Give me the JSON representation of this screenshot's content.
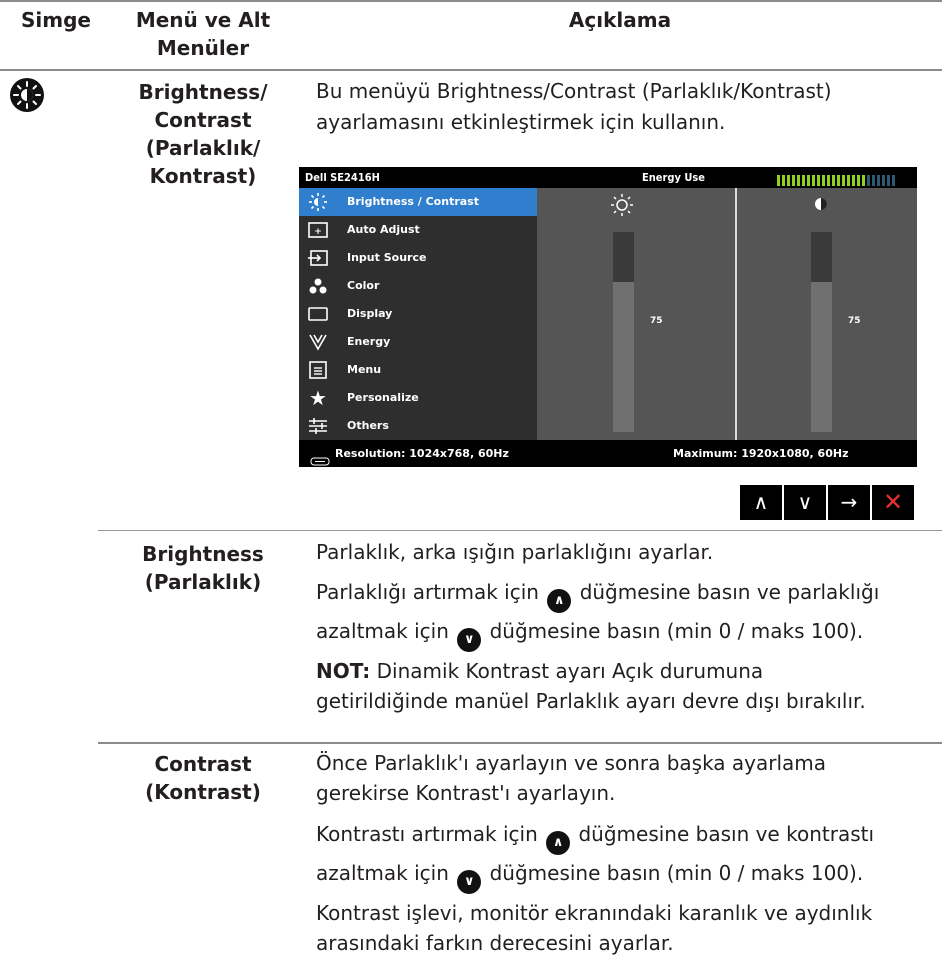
{
  "header": {
    "col_icon": "Simge",
    "col_menu": "Menü ve Alt Menüler",
    "col_desc": "Açıklama"
  },
  "main_row": {
    "icon": "brightness-contrast-icon",
    "menu_label_lines": [
      "Brightness/",
      "Contrast",
      "(Parlaklık/",
      "Kontrast)"
    ],
    "description": "Bu menüyü Brightness/Contrast (Parlaklık/Kontrast) ayarlamasını etkinleştirmek için kullanın."
  },
  "osd": {
    "model": "Dell SE2416H",
    "energy_label": "Energy Use",
    "menu_items": [
      {
        "label": "Brightness / Contrast",
        "icon": "brightness-icon",
        "selected": true
      },
      {
        "label": "Auto Adjust",
        "icon": "auto-adjust-icon",
        "selected": false
      },
      {
        "label": "Input Source",
        "icon": "input-source-icon",
        "selected": false
      },
      {
        "label": "Color",
        "icon": "color-icon",
        "selected": false
      },
      {
        "label": "Display",
        "icon": "display-icon",
        "selected": false
      },
      {
        "label": "Energy",
        "icon": "energy-icon",
        "selected": false
      },
      {
        "label": "Menu",
        "icon": "menu-icon",
        "selected": false
      },
      {
        "label": "Personalize",
        "icon": "star-icon",
        "selected": false
      },
      {
        "label": "Others",
        "icon": "others-icon",
        "selected": false
      }
    ],
    "brightness_value": "75",
    "contrast_value": "75",
    "brightness_level": 0.75,
    "contrast_level": 0.75,
    "resolution": "Resolution: 1024x768, 60Hz",
    "maximum": "Maximum: 1920x1080, 60Hz",
    "energy_bar_level": 0.75
  },
  "nav_buttons": [
    "up-icon",
    "down-icon",
    "right-arrow-icon",
    "close-icon"
  ],
  "rows": [
    {
      "label_lines": [
        "Brightness",
        "(Parlaklık)"
      ],
      "para1": "Parlaklık, arka ışığın parlaklığını ayarlar.",
      "para2_a": "Parlaklığı artırmak için",
      "para2_b": "düğmesine basın ve parlaklığı",
      "para2_c": "azaltmak için",
      "para2_d": "düğmesine basın (min 0 / maks 100).",
      "note_label": "NOT:",
      "note_line1": "Dinamik Kontrast ayarı Açık durumuna",
      "note_line2": "getirildiğinde manüel Parlaklık ayarı devre dışı bırakılır."
    },
    {
      "label_lines": [
        "Contrast",
        "(Kontrast)"
      ],
      "para1_line1": "Önce Parlaklık'ı ayarlayın ve sonra başka ayarlama",
      "para1_line2": "gerekirse Kontrast'ı ayarlayın.",
      "para2_a": "Kontrastı artırmak için",
      "para2_b": "düğmesine basın ve kontrastı",
      "para2_c": "azaltmak için",
      "para2_d": "düğmesine basın (min 0 / maks 100).",
      "para3_line1": "Kontrast işlevi, monitör ekranındaki karanlık ve aydınlık",
      "para3_line2": "arasındaki farkın derecesini ayarlar."
    }
  ]
}
